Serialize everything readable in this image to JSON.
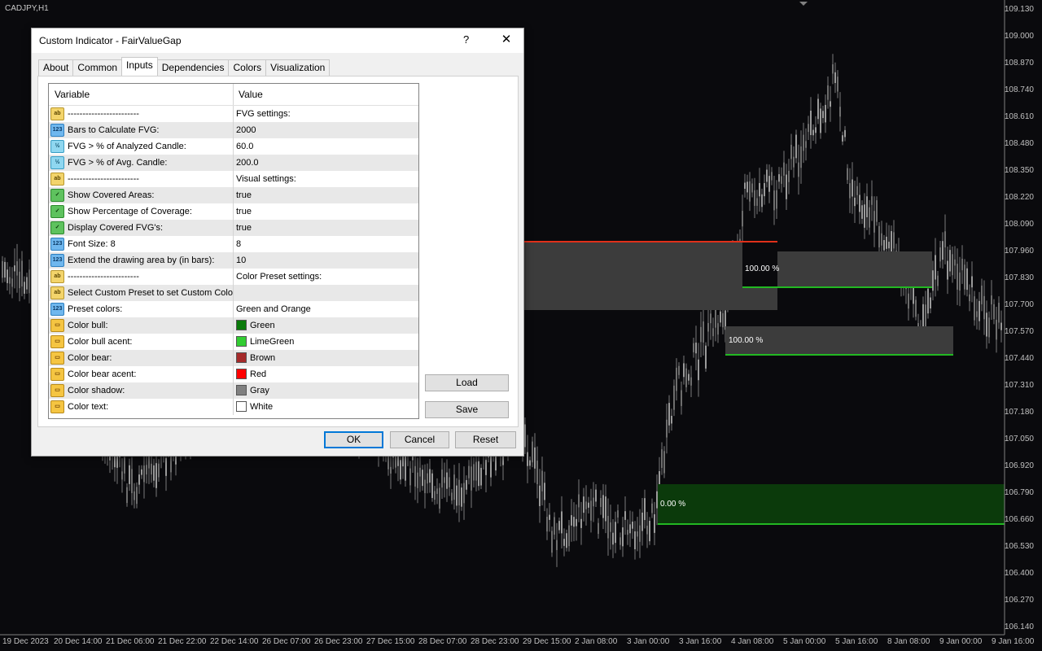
{
  "chart": {
    "symbol": "CADJPY,H1",
    "price_axis": [
      "109.130",
      "109.000",
      "108.870",
      "108.740",
      "108.610",
      "108.480",
      "108.350",
      "108.220",
      "108.090",
      "107.960",
      "107.830",
      "107.700",
      "107.570",
      "107.440",
      "107.310",
      "107.180",
      "107.050",
      "106.920",
      "106.790",
      "106.660",
      "106.530",
      "106.400",
      "106.270",
      "106.140"
    ],
    "time_axis": [
      "19 Dec 2023",
      "20 Dec 14:00",
      "21 Dec 06:00",
      "21 Dec 22:00",
      "22 Dec 14:00",
      "26 Dec 07:00",
      "26 Dec 23:00",
      "27 Dec 15:00",
      "28 Dec 07:00",
      "28 Dec 23:00",
      "29 Dec 15:00",
      "2 Jan 08:00",
      "3 Jan 00:00",
      "3 Jan 16:00",
      "4 Jan 08:00",
      "5 Jan 00:00",
      "5 Jan 16:00",
      "8 Jan 08:00",
      "9 Jan 00:00",
      "9 Jan 16:00"
    ],
    "zone_labels": [
      "100.00 %",
      "100.00 %",
      "0.00 %"
    ],
    "colors": {
      "background": "#0a0a0d",
      "candle": "#8a8a8a",
      "zone_gray": "#3c3c3c",
      "zone_green": "#0b3a0b",
      "bull_line": "#22b822",
      "bear_line": "#e0301a"
    }
  },
  "dialog": {
    "title": "Custom Indicator - FairValueGap",
    "help": "?",
    "close": "✕",
    "tabs": [
      "About",
      "Common",
      "Inputs",
      "Dependencies",
      "Colors",
      "Visualization"
    ],
    "active_tab": "Inputs",
    "columns": {
      "variable": "Variable",
      "value": "Value"
    },
    "rows": [
      {
        "icon": "ab",
        "variable": "------------------------",
        "value": "FVG settings:"
      },
      {
        "icon": "123",
        "variable": "Bars to Calculate FVG:",
        "value": "2000"
      },
      {
        "icon": "½",
        "variable": "FVG > % of Analyzed Candle:",
        "value": "60.0"
      },
      {
        "icon": "½",
        "variable": "FVG > % of Avg. Candle:",
        "value": "200.0"
      },
      {
        "icon": "ab",
        "variable": "------------------------",
        "value": "Visual settings:"
      },
      {
        "icon": "bool",
        "variable": "Show Covered Areas:",
        "value": "true"
      },
      {
        "icon": "bool",
        "variable": "Show Percentage of Coverage:",
        "value": "true"
      },
      {
        "icon": "bool",
        "variable": "Display Covered FVG's:",
        "value": "true"
      },
      {
        "icon": "123",
        "variable": "Font Size: 8",
        "value": "8"
      },
      {
        "icon": "123",
        "variable": "Extend the drawing area by (in bars):",
        "value": "10"
      },
      {
        "icon": "ab",
        "variable": "------------------------",
        "value": "Color Preset settings:"
      },
      {
        "icon": "ab",
        "variable": "Select Custom Preset to set Custom Colors",
        "value": ""
      },
      {
        "icon": "123",
        "variable": "Preset colors:",
        "value": "Green and Orange"
      },
      {
        "icon": "color",
        "variable": "Color bull:",
        "value": "Green",
        "swatch": "#0a7a0a"
      },
      {
        "icon": "color",
        "variable": "Color bull acent:",
        "value": "LimeGreen",
        "swatch": "#32cd32"
      },
      {
        "icon": "color",
        "variable": "Color bear:",
        "value": "Brown",
        "swatch": "#a52a2a"
      },
      {
        "icon": "color",
        "variable": "Color bear acent:",
        "value": "Red",
        "swatch": "#ff0000"
      },
      {
        "icon": "color",
        "variable": "Color shadow:",
        "value": "Gray",
        "swatch": "#808080"
      },
      {
        "icon": "color",
        "variable": "Color text:",
        "value": "White",
        "swatch": "#ffffff"
      }
    ],
    "buttons": {
      "load": "Load",
      "save": "Save",
      "ok": "OK",
      "cancel": "Cancel",
      "reset": "Reset"
    }
  }
}
